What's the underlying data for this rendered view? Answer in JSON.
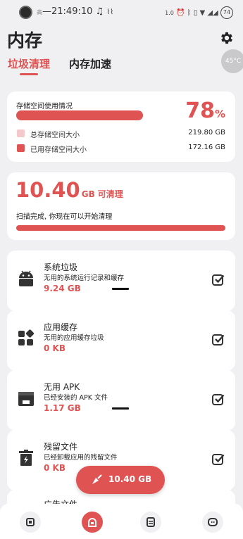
{
  "status_bar": {
    "time": "21:49:10",
    "carrier_small": "高",
    "speed_label": "1.0",
    "battery": "74"
  },
  "app": {
    "title": "内存",
    "temperature": "45°C",
    "tabs": [
      "垃圾清理",
      "内存加速"
    ]
  },
  "storage": {
    "title": "存储空间使用情况",
    "used_percent": 78,
    "percent_number": "78",
    "percent_unit": "%",
    "total_label": "总存储空间大小",
    "total_value": "219.80 GB",
    "used_label": "已用存储空间大小",
    "used_value": "172.16 GB"
  },
  "clean": {
    "size_number": "10.40",
    "size_unit": "GB",
    "action_label": "可清理",
    "message": "扫描完成, 你现在可以开始清理"
  },
  "items": [
    {
      "icon": "android-icon",
      "title": "系统垃圾",
      "desc": "无用的系统运行记录和缓存",
      "size": "9.24 GB",
      "checked": true
    },
    {
      "icon": "apps-grid-icon",
      "title": "应用缓存",
      "desc": "无用的应用缓存垃圾",
      "size": "0 KB",
      "checked": true
    },
    {
      "icon": "apk-box-icon",
      "title": "无用 APK",
      "desc": "已经安装的 APK 文件",
      "size": "1.17 GB",
      "checked": true
    },
    {
      "icon": "trash-icon",
      "title": "残留文件",
      "desc": "已经卸载应用的残留文件",
      "size": "0 KB",
      "checked": true
    },
    {
      "icon": "ad-icon",
      "title": "广告文件",
      "desc": "",
      "size": "",
      "checked": true
    }
  ],
  "fab": {
    "label": "10.40 GB"
  },
  "nav": [
    {
      "icon": "cpu-chip-icon",
      "active": false
    },
    {
      "icon": "cleaner-icon",
      "active": true
    },
    {
      "icon": "storage-icon",
      "active": false
    },
    {
      "icon": "assistant-icon",
      "active": false
    }
  ],
  "colors": {
    "accent": "#e05353",
    "total_legend": "#f5c9c9",
    "background": "#f0f0f2"
  }
}
